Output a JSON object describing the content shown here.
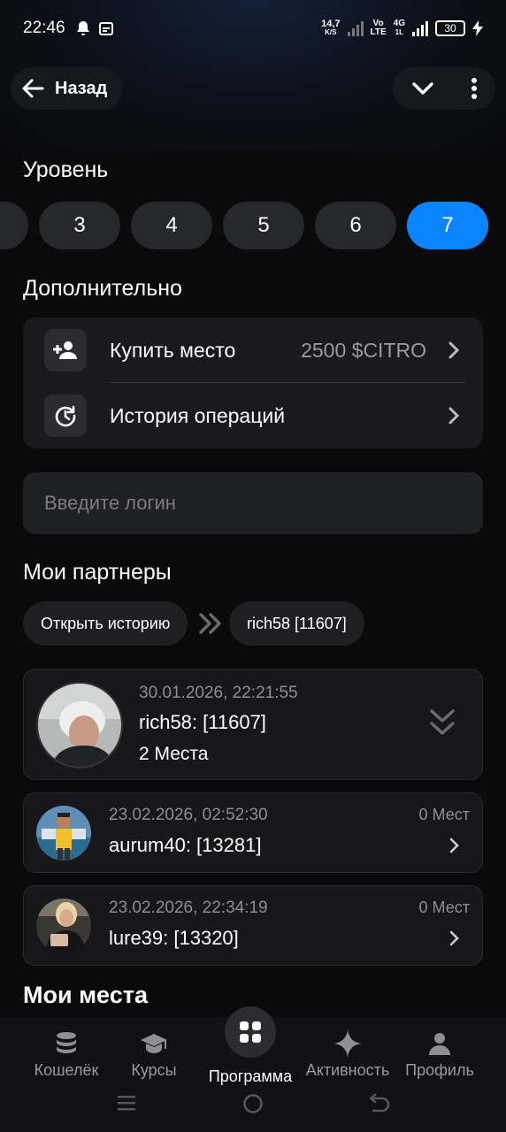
{
  "status_bar": {
    "time": "22:46",
    "speed_value": "14,7",
    "speed_unit": "K/S",
    "volte_top": "Vo",
    "volte_bottom": "LTE",
    "net_type": "4G",
    "net_sub": "1L",
    "battery": "30"
  },
  "header": {
    "back_label": "Назад"
  },
  "level_section": {
    "title": "Уровень",
    "levels": [
      "3",
      "4",
      "5",
      "6",
      "7"
    ],
    "selected": "7"
  },
  "additional": {
    "title": "Дополнительно",
    "items": [
      {
        "label": "Купить место",
        "value": "2500 $CITRO",
        "icon": "add-person-icon"
      },
      {
        "label": "История операций",
        "value": "",
        "icon": "history-icon"
      }
    ]
  },
  "login_input": {
    "placeholder": "Введите логин",
    "value": ""
  },
  "partners": {
    "title": "Мои партнеры",
    "open_history_label": "Открыть историю",
    "breadcrumb_user": "rich58 [11607]",
    "expanded": {
      "date": "30.01.2026, 22:21:55",
      "name": "rich58: [11607]",
      "places": "2 Места"
    },
    "items": [
      {
        "date": "23.02.2026, 02:52:30",
        "name": "aurum40: [13281]",
        "count": "0 Мест"
      },
      {
        "date": "23.02.2026, 22:34:19",
        "name": "lure39: [13320]",
        "count": "0 Мест"
      }
    ]
  },
  "my_places": {
    "title": "Мои места"
  },
  "bottom_nav": {
    "items": [
      {
        "label": "Кошелёк",
        "icon": "wallet-coins-icon"
      },
      {
        "label": "Курсы",
        "icon": "graduation-cap-icon"
      },
      {
        "label": "Программа",
        "icon": "grid-icon"
      },
      {
        "label": "Активность",
        "icon": "sparkle-icon"
      },
      {
        "label": "Профиль",
        "icon": "person-icon"
      }
    ],
    "active": "Программа"
  },
  "colors": {
    "accent": "#0a84ff",
    "background": "#0a0a0b",
    "card": "#1a1a1d"
  }
}
